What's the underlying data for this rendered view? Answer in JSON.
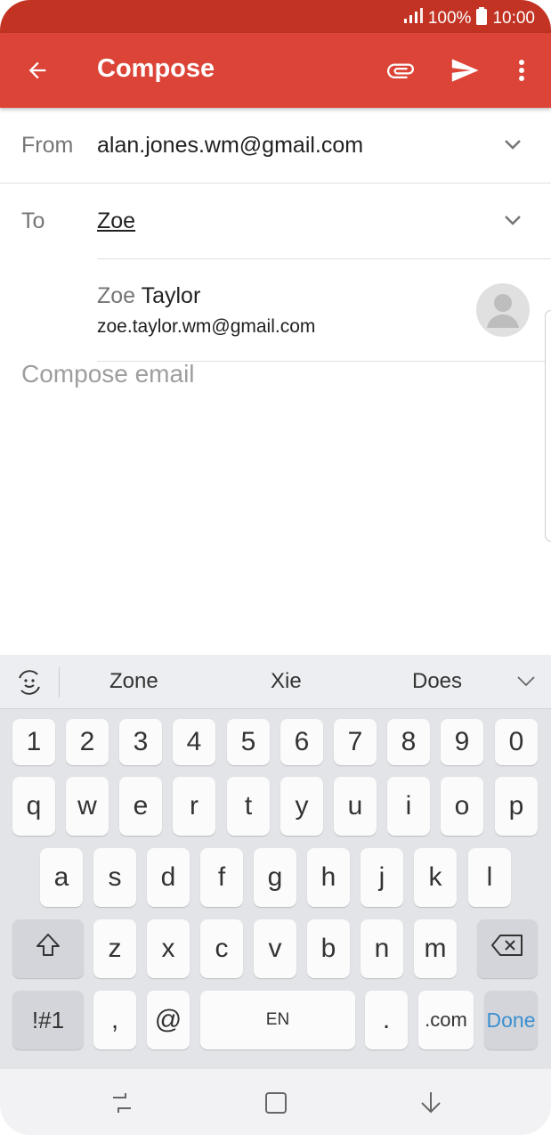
{
  "status_bar": {
    "battery": "100%",
    "time": "10:00"
  },
  "app_bar": {
    "title": "Compose"
  },
  "from": {
    "label": "From",
    "value": "alan.jones.wm@gmail.com"
  },
  "to": {
    "label": "To",
    "value": "Zoe"
  },
  "suggestion": {
    "name_typed": "Zoe",
    "name_rest": " Taylor",
    "email": "zoe.taylor.wm@gmail.com"
  },
  "body": {
    "placeholder": "Compose email"
  },
  "keyboard": {
    "suggestions": [
      "Zone",
      "Xie",
      "Does"
    ],
    "row_numbers": [
      "1",
      "2",
      "3",
      "4",
      "5",
      "6",
      "7",
      "8",
      "9",
      "0"
    ],
    "row1": [
      "q",
      "w",
      "e",
      "r",
      "t",
      "y",
      "u",
      "i",
      "o",
      "p"
    ],
    "row2": [
      "a",
      "s",
      "d",
      "f",
      "g",
      "h",
      "j",
      "k",
      "l"
    ],
    "row3": [
      "z",
      "x",
      "c",
      "v",
      "b",
      "n",
      "m"
    ],
    "symbols": "!#1",
    "comma": ",",
    "at": "@",
    "space": "EN",
    "period": ".",
    "dotcom": ".com",
    "done": "Done"
  },
  "colors": {
    "app_bar": "#db4437",
    "status_bar": "#c23323",
    "done": "#3b8fd0"
  }
}
